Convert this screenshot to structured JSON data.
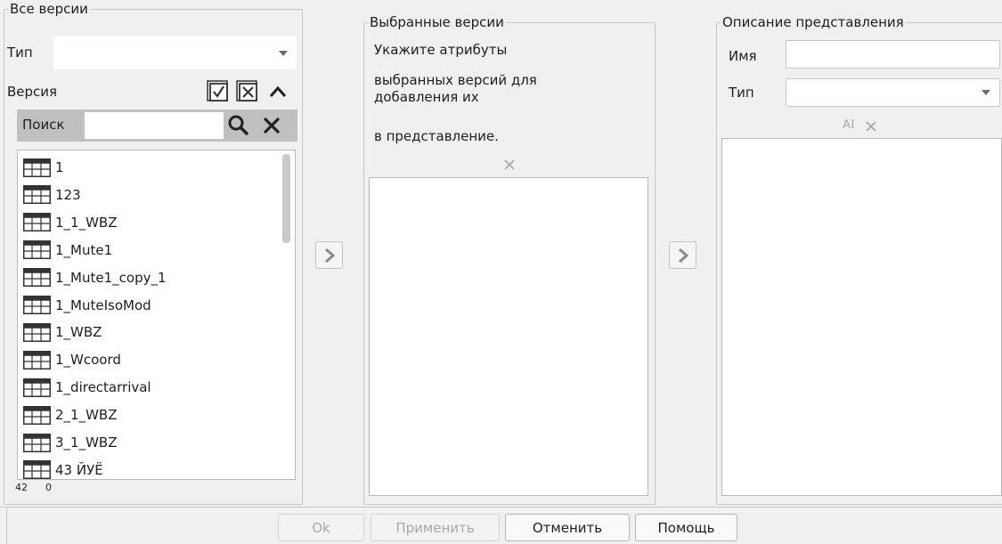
{
  "all_versions": {
    "title": "Все версии",
    "type_label": "Тип",
    "type_value": "",
    "version_label": "Версия",
    "search_label": "Поиск",
    "search_value": "",
    "items": [
      "1",
      "123",
      "1_1_WBZ",
      "1_Mute1",
      "1_Mute1_copy_1",
      "1_MuteIsoMod",
      "1_WBZ",
      "1_Wcoord",
      "1_directarrival",
      "2_1_WBZ",
      "3_1_WBZ",
      "43 ЙУЁ"
    ],
    "count_total": "42",
    "count_selected": "0"
  },
  "selected_versions": {
    "title": "Выбранные версии",
    "hint_line1": "Укажите атрибуты",
    "hint_line2": "выбранных версий для добавления их",
    "hint_line3": "в представление."
  },
  "view_description": {
    "title": "Описание представления",
    "name_label": "Имя",
    "name_value": "",
    "type_label": "Тип",
    "type_value": ""
  },
  "buttons": {
    "ok": "Ok",
    "apply": "Применить",
    "cancel": "Отменить",
    "help": "Помощь"
  },
  "colors": {
    "search_bar_bg": "#c0c0c0",
    "window_bg": "#f0f0f0",
    "disabled_text": "#a8a8a8"
  }
}
